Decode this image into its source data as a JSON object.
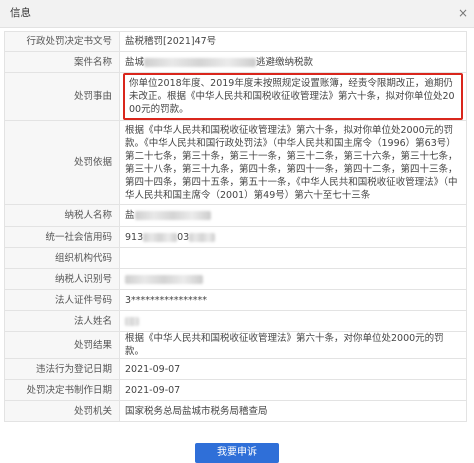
{
  "dialog": {
    "title": "信息",
    "close_glyph": "×"
  },
  "rows": {
    "doc_no": {
      "label": "行政处罚决定书文号",
      "value": "盐税稽罚[2021]47号"
    },
    "case_name": {
      "label": "案件名称",
      "prefix": "盐城",
      "suffix": "逃避缴纳税款"
    },
    "reason": {
      "label": "处罚事由",
      "value": "你单位2018年度、2019年度未按照规定设置账簿，经责令限期改正，逾期仍未改正。根据《中华人民共和国税收征收管理法》第六十条，拟对你单位处2000元的罚款。"
    },
    "basis": {
      "label": "处罚依据",
      "value": "根据《中华人民共和国税收征收管理法》第六十条，拟对你单位处2000元的罚款。《中华人民共和国行政处罚法》（中华人民共和国主席令（1996）第63号）第二十七条，第三十条，第三十一条，第三十二条，第三十六条，第三十七条，第三十八条，第三十九条，第四十条，第四十一条，第四十二条，第四十三条，第四十四条，第四十五条，第五十一条，《中华人民共和国税收征收管理法》（中华人民共和国主席令（2001）第49号）第六十至七十三条"
    },
    "taxpayer_name": {
      "label": "纳税人名称",
      "value": "盐"
    },
    "credit_code": {
      "label": "统一社会信用码",
      "prefix": "913",
      "middle": "03"
    },
    "org_code": {
      "label": "组织机构代码",
      "value": ""
    },
    "taxpayer_id": {
      "label": "纳税人识别号",
      "value": ""
    },
    "legal_id": {
      "label": "法人证件号码",
      "value": "3****************"
    },
    "legal_name": {
      "label": "法人姓名",
      "value": ""
    },
    "result": {
      "label": "处罚结果",
      "value": "根据《中华人民共和国税收征收管理法》第六十条，对你单位处2000元的罚款。"
    },
    "illegal_date": {
      "label": "违法行为登记日期",
      "value": "2021-09-07"
    },
    "decision_date": {
      "label": "处罚决定书制作日期",
      "value": "2021-09-07"
    },
    "authority": {
      "label": "处罚机关",
      "value": "国家税务总局盐城市税务局稽查局"
    }
  },
  "appeal_button": "我要申诉",
  "colors": {
    "highlight_border": "#d9261c",
    "button": "#2f6fd8"
  }
}
